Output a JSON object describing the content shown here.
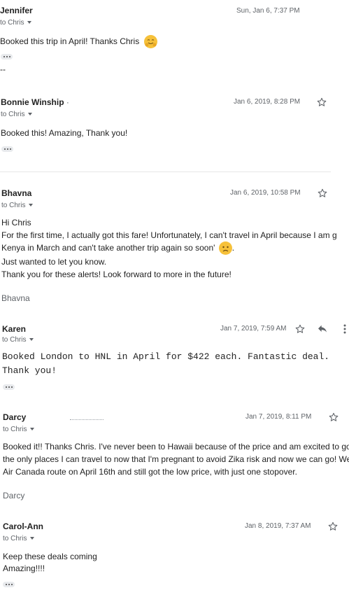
{
  "messages": [
    {
      "sender": "Jennifer",
      "to": "to Chris",
      "date": "Sun, Jan 6, 7:37 PM",
      "body": [
        "Booked this trip in April! Thanks Chris"
      ],
      "extra": "--"
    },
    {
      "sender": "Bonnie Winship",
      "sender_suffix": "·",
      "to": "to Chris",
      "date": "Jan 6, 2019, 8:28 PM",
      "body": [
        "Booked this! Amazing, Thank you!"
      ]
    },
    {
      "sender": "Bhavna",
      "to": "to Chris",
      "date": "Jan 6, 2019, 10:58 PM",
      "body": [
        "Hi Chris",
        "For the first time, I actually got this fare!  Unfortunately, I can't travel in April because I am g",
        "Kenya in March and can't take another trip again so soon'",
        "Just wanted to let you know.",
        "Thank you for these alerts!  Look forward to more in the future!"
      ],
      "signature": "Bhavna"
    },
    {
      "sender": "Karen",
      "to": "to Chris",
      "date": "Jan 7, 2019, 7:59 AM",
      "body": [
        "Booked London to HNL in April for $422 each.  Fantastic deal.",
        "Thank you!"
      ]
    },
    {
      "sender": "Darcy",
      "to": "to Chris",
      "date": "Jan 7, 2019, 8:11 PM",
      "body": [
        "Booked it!!   Thanks Chris.  I've never been to Hawaii because of the price and am excited to go",
        "the only places I can travel to now that I'm pregnant to avoid Zika risk and now we can go!   We",
        "Air Canada route on April 16th and still got the low price, with just one stopover."
      ],
      "signature": "Darcy"
    },
    {
      "sender": "Carol-Ann",
      "to": "to Chris",
      "date": "Jan 8, 2019, 7:37 AM",
      "body": [
        "Keep these deals coming",
        "Amazing!!!!"
      ]
    }
  ],
  "icons": {
    "star": "star-outline-icon",
    "reply": "reply-icon",
    "more": "more-vert-icon",
    "trimmed": "show-trimmed-content-icon",
    "emoji_hug": "hugging-face-emoji",
    "emoji_sad": "sad-face-emoji"
  },
  "colors": {
    "icon": "#5f6368",
    "emoji": "#f6c13a",
    "divider": "#e6e6e6"
  }
}
